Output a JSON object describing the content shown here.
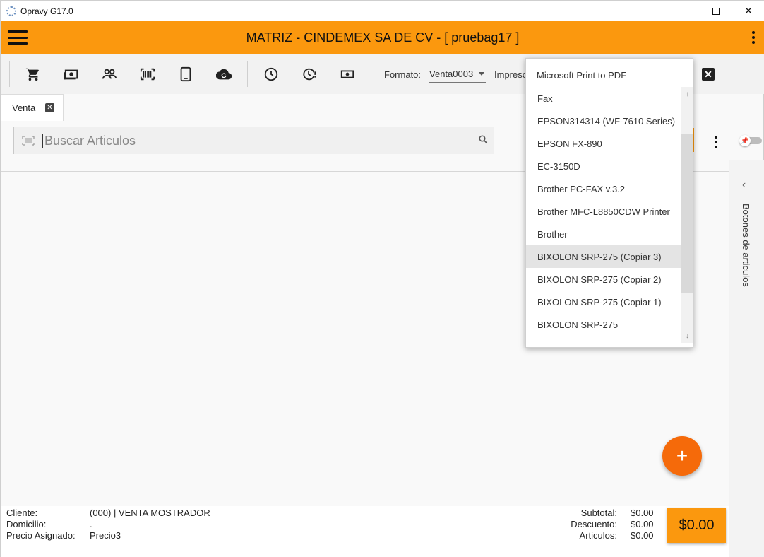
{
  "window": {
    "title": "Opravy G17.0"
  },
  "header": {
    "title": "MATRIZ - CINDEMEX SA DE CV - [ pruebag17 ]"
  },
  "toolbar": {
    "formato_label": "Formato:",
    "formato_value": "Venta0003",
    "impresora_label": "Impresora"
  },
  "tabs": [
    {
      "label": "Venta"
    }
  ],
  "search": {
    "placeholder": "Buscar Articulos"
  },
  "printer_dropdown": {
    "options": [
      "Microsoft Print to PDF",
      "Fax",
      "EPSON314314 (WF-7610 Series)",
      "EPSON FX-890",
      "EC-3150D",
      "Brother PC-FAX v.3.2",
      "Brother MFC-L8850CDW Printer",
      "Brother",
      "BIXOLON SRP-275 (Copiar 3)",
      "BIXOLON SRP-275 (Copiar 2)",
      "BIXOLON SRP-275 (Copiar 1)",
      "BIXOLON SRP-275"
    ],
    "highlighted": "BIXOLON SRP-275 (Copiar 3)"
  },
  "right_panel": {
    "label": "Botones de articulos"
  },
  "footer": {
    "cliente_label": "Cliente:",
    "cliente_value": "(000) | VENTA MOSTRADOR",
    "domicilio_label": "Domicilio:",
    "domicilio_value": ".",
    "precio_label": "Precio Asignado:",
    "precio_value": "Precio3",
    "subtotal_label": "Subtotal:",
    "subtotal_value": "$0.00",
    "descuento_label": "Descuento:",
    "descuento_value": "$0.00",
    "articulos_label": "Articulos:",
    "articulos_value": "$0.00",
    "total_button": "$0.00"
  },
  "fab": {
    "label": "+"
  },
  "colors": {
    "accent": "#fb980e",
    "fab": "#f56a0a"
  }
}
